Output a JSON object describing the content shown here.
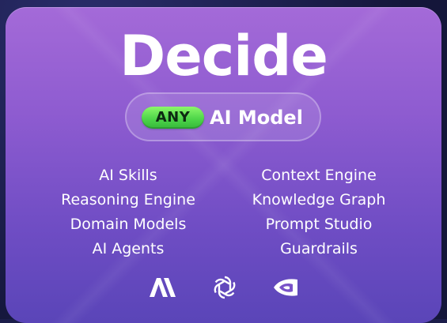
{
  "card": {
    "title": "Decide",
    "badge": "ANY",
    "subtitle": "AI Model"
  },
  "features": {
    "left": [
      "AI Skills",
      "Reasoning Engine",
      "Domain Models",
      "AI Agents"
    ],
    "right": [
      "Context Engine",
      "Knowledge Graph",
      "Prompt Studio",
      "Guardrails"
    ]
  },
  "logos": [
    {
      "icon": "anthropic-icon"
    },
    {
      "icon": "openai-icon"
    },
    {
      "icon": "nvidia-icon"
    }
  ],
  "colors": {
    "card_top": "#a46ad8",
    "card_bottom": "#5a45b8",
    "badge_green": "#4fd64a",
    "text": "#ffffff"
  }
}
